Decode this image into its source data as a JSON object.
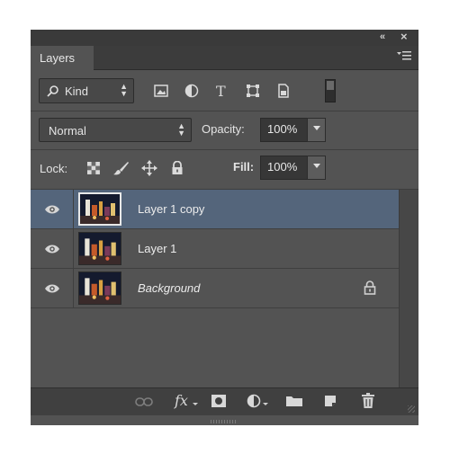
{
  "panel": {
    "tab_label": "Layers",
    "collapse_glyph": "«",
    "close_glyph": "×",
    "menu_icon": "panel-menu-icon"
  },
  "filter_bar": {
    "kind_label": "Kind",
    "icons": [
      "pixel-filter-icon",
      "adjustment-filter-icon",
      "type-filter-icon",
      "shape-filter-icon",
      "smart-object-filter-icon",
      "filter-toggle-icon"
    ]
  },
  "blend_bar": {
    "blend_mode": "Normal",
    "opacity_label": "Opacity:",
    "opacity_value": "100%"
  },
  "lock_bar": {
    "lock_label": "Lock:",
    "fill_label": "Fill:",
    "fill_value": "100%",
    "icons": [
      "lock-transparent-icon",
      "lock-image-icon",
      "lock-position-icon",
      "lock-all-icon"
    ]
  },
  "layers": [
    {
      "name": "Layer 1 copy",
      "selected": true,
      "italic": false,
      "locked": false,
      "visible": true
    },
    {
      "name": "Layer 1",
      "selected": false,
      "italic": false,
      "locked": false,
      "visible": true
    },
    {
      "name": "Background",
      "selected": false,
      "italic": true,
      "locked": true,
      "visible": true
    }
  ],
  "bottom_bar": {
    "fx_label": "fx",
    "icons": [
      "link-layers-icon",
      "layer-style-icon",
      "layer-mask-icon",
      "adjustment-layer-icon",
      "new-group-icon",
      "new-layer-icon",
      "delete-layer-icon"
    ]
  },
  "colors": {
    "panel_bg": "#535353",
    "selected_row": "#54657b",
    "text": "#e4e4e4"
  }
}
